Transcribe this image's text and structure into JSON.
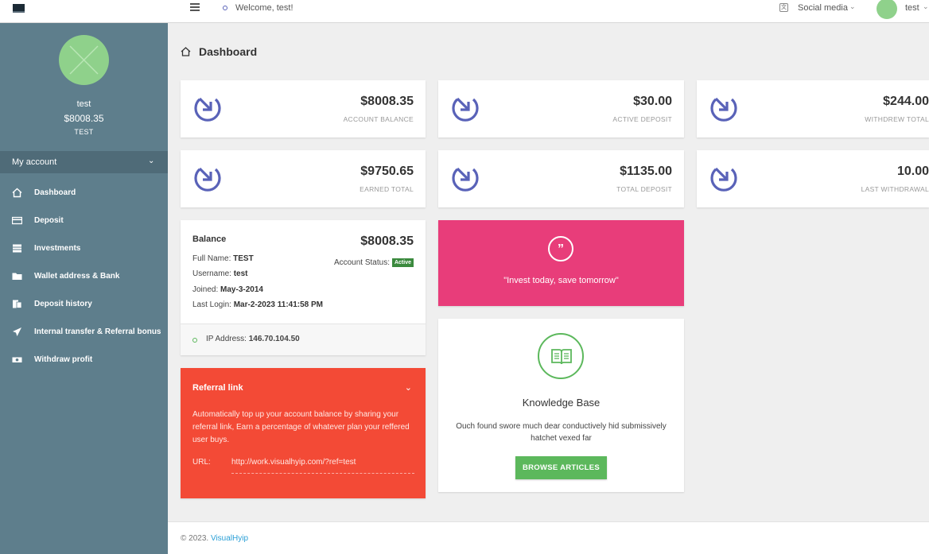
{
  "topbar": {
    "welcome": "Welcome, test!",
    "social_media": "Social media",
    "username": "test"
  },
  "sidebar": {
    "name": "test",
    "balance": "$8008.35",
    "sub": "TEST",
    "account_label": "My account",
    "items": [
      {
        "label": "Dashboard",
        "icon": "home-icon"
      },
      {
        "label": "Deposit",
        "icon": "card-icon"
      },
      {
        "label": "Investments",
        "icon": "stack-icon"
      },
      {
        "label": "Wallet address & Bank",
        "icon": "folder-icon"
      },
      {
        "label": "Deposit history",
        "icon": "history-icon"
      },
      {
        "label": "Internal transfer & Referral bonus",
        "icon": "send-icon"
      },
      {
        "label": "Withdraw profit",
        "icon": "money-icon"
      }
    ]
  },
  "page": {
    "title": "Dashboard"
  },
  "stats": [
    {
      "value": "$8008.35",
      "label": "ACCOUNT BALANCE"
    },
    {
      "value": "$30.00",
      "label": "ACTIVE DEPOSIT"
    },
    {
      "value": "$244.00",
      "label": "WITHDREW TOTAL"
    },
    {
      "value": "$9750.65",
      "label": "EARNED TOTAL"
    },
    {
      "value": "$1135.00",
      "label": "TOTAL DEPOSIT"
    },
    {
      "value": "10.00",
      "label": "LAST WITHDRAWAL"
    }
  ],
  "balance": {
    "title": "Balance",
    "amount": "$8008.35",
    "full_name_label": "Full Name:",
    "full_name": "TEST",
    "username_label": "Username:",
    "username": "test",
    "joined_label": "Joined:",
    "joined": "May-3-2014",
    "last_login_label": "Last Login:",
    "last_login": "Mar-2-2023 11:41:58 PM",
    "status_label": "Account Status:",
    "status": "Active",
    "ip_label": "IP Address:",
    "ip": "146.70.104.50"
  },
  "referral": {
    "title": "Referral link",
    "text": "Automatically top up your account balance by sharing your referral link, Earn a percentage of whatever plan your reffered user buys.",
    "url_label": "URL:",
    "url": "http://work.visualhyip.com/?ref=test"
  },
  "quote": {
    "text": "\"Invest today, save tomorrow\""
  },
  "knowledge": {
    "title": "Knowledge Base",
    "description": "Ouch found swore much dear conductively hid submissively hatchet vexed far",
    "button": "BROWSE ARTICLES"
  },
  "footer": {
    "copyright": "© 2023.",
    "brand": "VisualHyip"
  },
  "colors": {
    "sidebar": "#5e7e8c",
    "accent_icon": "#5962b8",
    "referral": "#f34a36",
    "quote": "#e83d7a",
    "success": "#5cb85c"
  }
}
